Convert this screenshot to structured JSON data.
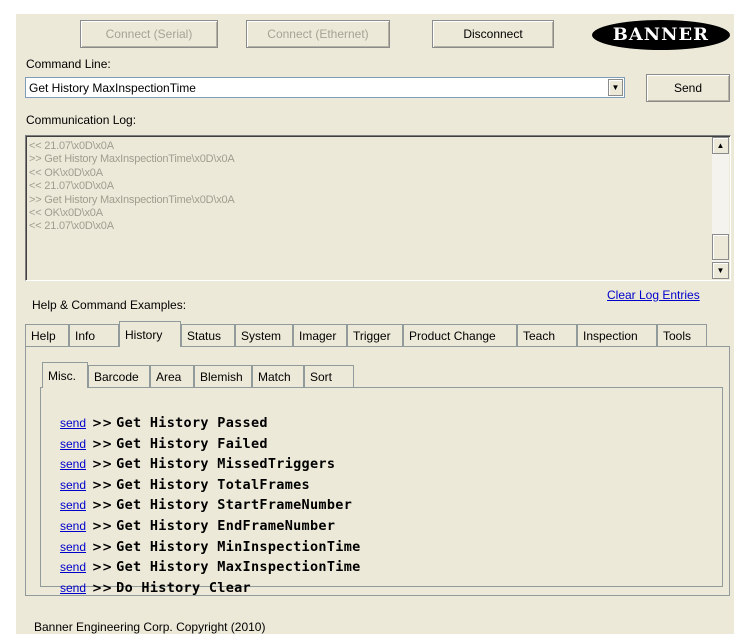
{
  "toolbar": {
    "connect_serial": "Connect (Serial)",
    "connect_ethernet": "Connect (Ethernet)",
    "disconnect": "Disconnect",
    "logo_text": "BANNER"
  },
  "command": {
    "label": "Command Line:",
    "value": "Get History MaxInspectionTime",
    "send": "Send"
  },
  "log": {
    "label": "Communication Log:",
    "lines": [
      "<< 21.07\\x0D\\x0A",
      ">> Get History MaxInspectionTime\\x0D\\x0A",
      "<< OK\\x0D\\x0A",
      "<< 21.07\\x0D\\x0A",
      ">> Get History MaxInspectionTime\\x0D\\x0A",
      "<< OK\\x0D\\x0A",
      "<< 21.07\\x0D\\x0A"
    ],
    "clear": "Clear Log Entries"
  },
  "help": {
    "label": "Help & Command Examples:",
    "tabs": [
      "Help",
      "Info",
      "History",
      "Status",
      "System",
      "Imager",
      "Trigger",
      "Product Change",
      "Teach",
      "Inspection",
      "Tools"
    ],
    "active_tab": "History",
    "subtabs": [
      "Misc.",
      "Barcode",
      "Area",
      "Blemish",
      "Match",
      "Sort"
    ],
    "active_subtab": "Misc.",
    "send_label": "send",
    "arrow": ">>",
    "commands": [
      "Get History Passed",
      "Get History Failed",
      "Get History MissedTriggers",
      "Get History TotalFrames",
      "Get History StartFrameNumber",
      "Get History EndFrameNumber",
      "Get History MinInspectionTime",
      "Get History MaxInspectionTime",
      "Do History Clear"
    ]
  },
  "footer": {
    "copyright": "Banner Engineering Corp. Copyright (2010)"
  }
}
